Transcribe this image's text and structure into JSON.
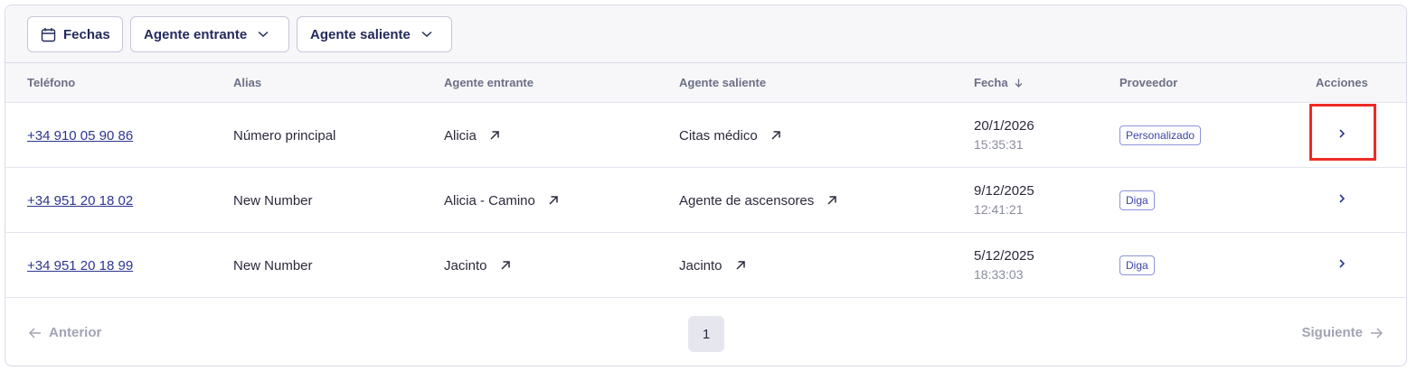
{
  "filters": {
    "dates_label": "Fechas",
    "inbound_label": "Agente entrante",
    "outbound_label": "Agente saliente"
  },
  "table": {
    "headers": {
      "phone": "Teléfono",
      "alias": "Alias",
      "inbound": "Agente entrante",
      "outbound": "Agente saliente",
      "date": "Fecha",
      "provider": "Proveedor",
      "actions": "Acciones"
    },
    "rows": [
      {
        "phone": "+34 910 05 90 86",
        "alias": "Número principal",
        "inbound": "Alicia",
        "outbound": "Citas médico",
        "date": "20/1/2026",
        "time": "15:35:31",
        "provider": "Personalizado"
      },
      {
        "phone": "+34 951 20 18 02",
        "alias": "New Number",
        "inbound": "Alicia - Camino",
        "outbound": "Agente de ascensores",
        "date": "9/12/2025",
        "time": "12:41:21",
        "provider": "Diga"
      },
      {
        "phone": "+34 951 20 18 99",
        "alias": "New Number",
        "inbound": "Jacinto",
        "outbound": "Jacinto",
        "date": "5/12/2025",
        "time": "18:33:03",
        "provider": "Diga"
      }
    ]
  },
  "pagination": {
    "prev_label": "Anterior",
    "next_label": "Siguiente",
    "current_page": "1"
  },
  "icons": {
    "calendar": "calendar-icon",
    "chevron_down": "chevron-down-icon",
    "sort_down": "arrow-down-icon",
    "external": "arrow-up-right-icon",
    "row_action": "chevron-right-icon",
    "prev": "arrow-left-icon",
    "next": "arrow-right-icon"
  },
  "colors": {
    "accent": "#2c3591",
    "badge_border": "#8e93d9",
    "highlight": "#ee2b24",
    "muted": "#a2a4b5"
  }
}
